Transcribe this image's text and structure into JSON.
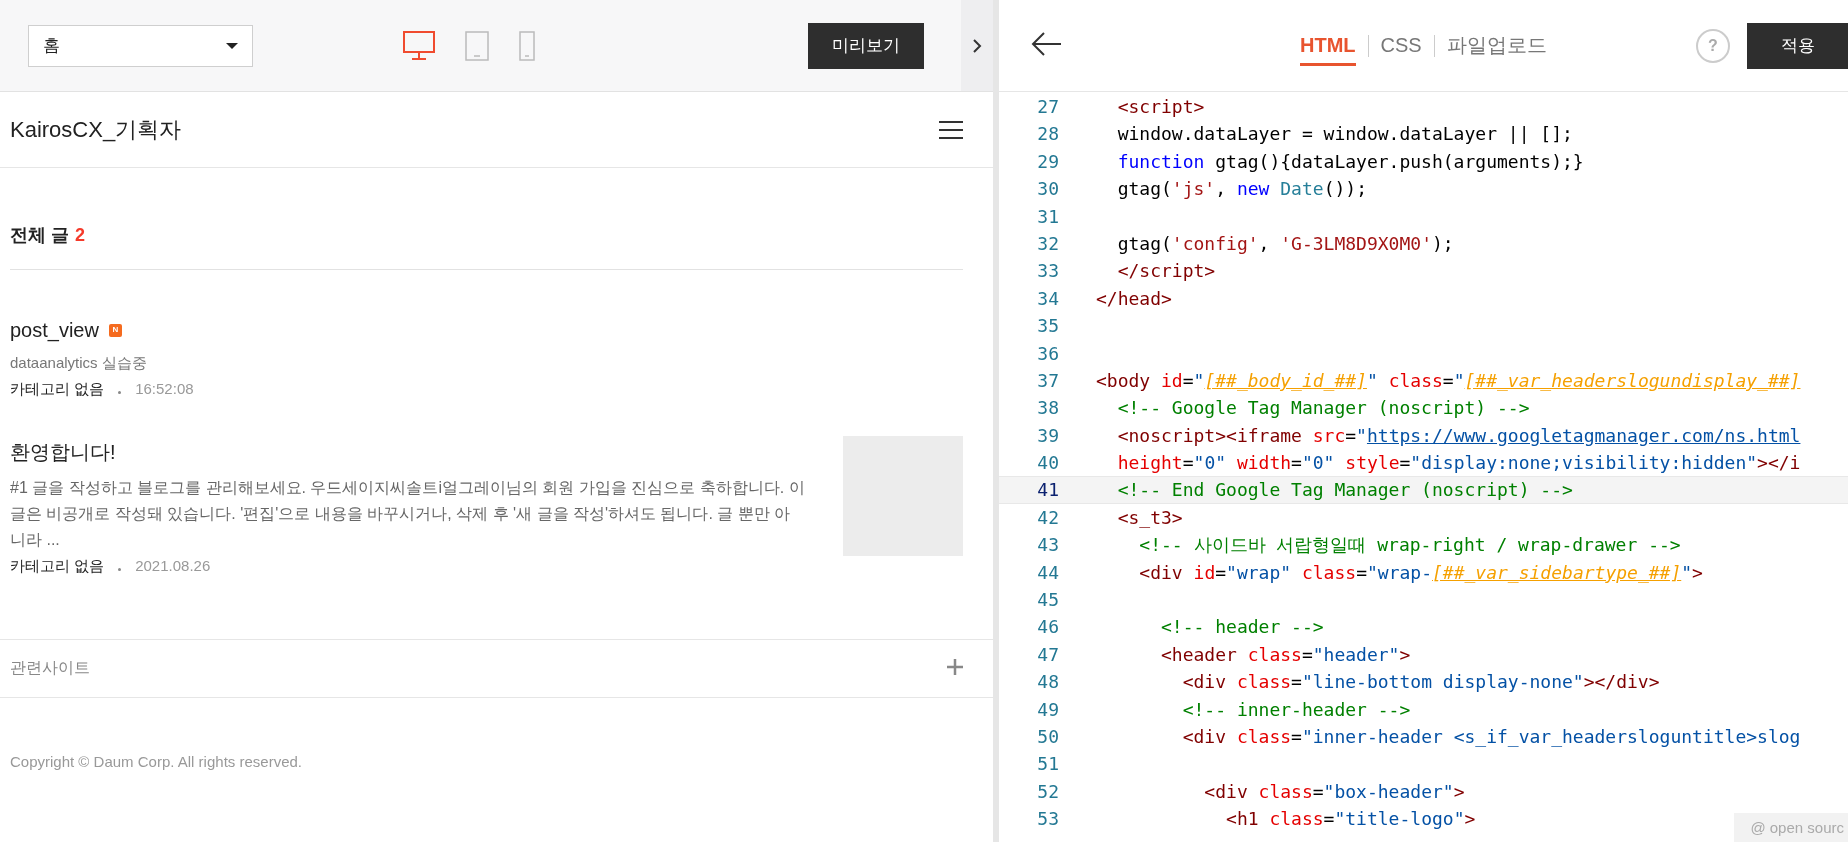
{
  "toolbar": {
    "page_select": {
      "value": "홈"
    },
    "devices": [
      {
        "kind": "desktop",
        "selected": true
      },
      {
        "kind": "tablet",
        "selected": false
      },
      {
        "kind": "mobile",
        "selected": false
      }
    ],
    "preview_button": "미리보기"
  },
  "blog": {
    "title": "KairosCX_기획자",
    "section": {
      "label": "전체 글",
      "count": "2"
    },
    "posts": [
      {
        "title": "post_view",
        "badge": "N",
        "summary": "dataanalytics 실습중",
        "category": "카테고리 없음",
        "time": "16:52:08",
        "thumbnail": false
      },
      {
        "title": "환영합니다!",
        "summary": "#1 글을 작성하고 블로그를 관리해보세요. 우드세이지씨솔트i얼그레이님의 회원 가입을 진심으로 축하합니다. 이 글은 비공개로 작성돼 있습니다. '편집'으로 내용을 바꾸시거나, 삭제 후 '새 글을 작성'하셔도 됩니다. 글 뿐만 아니라 ...",
        "category": "카테고리 없음",
        "time": "2021.08.26",
        "thumbnail": true
      }
    ],
    "related": {
      "label": "관련사이트"
    },
    "copyright": "Copyright © Daum Corp. All rights reserved."
  },
  "editor": {
    "tabs": [
      {
        "label": "HTML",
        "selected": true
      },
      {
        "label": "CSS",
        "selected": false
      },
      {
        "label": "파일업로드",
        "selected": false
      }
    ],
    "help_button": "?",
    "apply_button": "적용",
    "lines": [
      {
        "number": "27",
        "current": false,
        "tokens": [
          {
            "kind": "tag",
            "text": "  <script>"
          }
        ]
      },
      {
        "number": "28",
        "current": false,
        "tokens": [
          {
            "kind": "plain",
            "text": "  window.dataLayer = window.dataLayer || [];"
          }
        ]
      },
      {
        "number": "29",
        "current": false,
        "tokens": [
          {
            "kind": "keyword",
            "text": "  function"
          },
          {
            "kind": "plain",
            "text": " gtag(){dataLayer.push(arguments);}"
          }
        ]
      },
      {
        "number": "30",
        "current": false,
        "tokens": [
          {
            "kind": "plain",
            "text": "  gtag("
          },
          {
            "kind": "string",
            "text": "'js'"
          },
          {
            "kind": "plain",
            "text": ", "
          },
          {
            "kind": "keyword",
            "text": "new "
          },
          {
            "kind": "type",
            "text": "Date"
          },
          {
            "kind": "plain",
            "text": "());"
          }
        ]
      },
      {
        "number": "31",
        "current": false
      },
      {
        "number": "32",
        "current": false,
        "tokens": [
          {
            "kind": "plain",
            "text": "  gtag("
          },
          {
            "kind": "string",
            "text": "'config'"
          },
          {
            "kind": "plain",
            "text": ", "
          },
          {
            "kind": "string",
            "text": "'G-3LM8D9X0M0'"
          },
          {
            "kind": "plain",
            "text": ");"
          }
        ]
      },
      {
        "number": "33",
        "current": false,
        "tokens": [
          {
            "kind": "tag",
            "text": "  </script>"
          }
        ]
      },
      {
        "number": "34",
        "current": false,
        "tokens": [
          {
            "kind": "tag",
            "text": "</head>"
          }
        ]
      },
      {
        "number": "35",
        "current": false
      },
      {
        "number": "36",
        "current": false
      },
      {
        "number": "37",
        "current": false,
        "tokens": [
          {
            "kind": "tag",
            "text": "<body"
          },
          {
            "kind": "attr",
            "text": " id"
          },
          {
            "kind": "plain",
            "text": "="
          },
          {
            "kind": "value",
            "text": "\""
          },
          {
            "kind": "var",
            "text": "[##_body_id_##]"
          },
          {
            "kind": "value",
            "text": "\""
          },
          {
            "kind": "attr",
            "text": " class"
          },
          {
            "kind": "plain",
            "text": "="
          },
          {
            "kind": "value",
            "text": "\""
          },
          {
            "kind": "var",
            "text": "[##_var_headerslogundisplay_##]"
          }
        ]
      },
      {
        "number": "38",
        "current": false,
        "tokens": [
          {
            "kind": "comment",
            "text": "  <!-- Google Tag Manager (noscript) -->"
          }
        ]
      },
      {
        "number": "39",
        "current": false,
        "tokens": [
          {
            "kind": "tag",
            "text": "  <noscript><iframe"
          },
          {
            "kind": "attr",
            "text": " src"
          },
          {
            "kind": "plain",
            "text": "="
          },
          {
            "kind": "value",
            "text": "\""
          },
          {
            "kind": "link",
            "text": "https://www.googletagmanager.com/ns.html"
          }
        ]
      },
      {
        "number": "40",
        "current": false,
        "tokens": [
          {
            "kind": "attr",
            "text": "  height"
          },
          {
            "kind": "plain",
            "text": "="
          },
          {
            "kind": "value",
            "text": "\"0\""
          },
          {
            "kind": "attr",
            "text": " width"
          },
          {
            "kind": "plain",
            "text": "="
          },
          {
            "kind": "value",
            "text": "\"0\""
          },
          {
            "kind": "attr",
            "text": " style"
          },
          {
            "kind": "plain",
            "text": "="
          },
          {
            "kind": "value",
            "text": "\"display:none;visibility:hidden\""
          },
          {
            "kind": "tag",
            "text": "></i"
          }
        ]
      },
      {
        "number": "41",
        "current": true,
        "tokens": [
          {
            "kind": "comment",
            "text": "  <!-- End Google Tag Manager (noscript) -->"
          }
        ]
      },
      {
        "number": "42",
        "current": false,
        "tokens": [
          {
            "kind": "tag",
            "text": "  <s_t3>"
          }
        ]
      },
      {
        "number": "43",
        "current": false,
        "tokens": [
          {
            "kind": "comment",
            "text": "    <!-- 사이드바 서랍형일때 wrap-right / wrap-drawer -->"
          }
        ]
      },
      {
        "number": "44",
        "current": false,
        "tokens": [
          {
            "kind": "tag",
            "text": "    <div"
          },
          {
            "kind": "attr",
            "text": " id"
          },
          {
            "kind": "plain",
            "text": "="
          },
          {
            "kind": "value",
            "text": "\"wrap\""
          },
          {
            "kind": "attr",
            "text": " class"
          },
          {
            "kind": "plain",
            "text": "="
          },
          {
            "kind": "value",
            "text": "\"wrap-"
          },
          {
            "kind": "var",
            "text": "[##_var_sidebartype_##]"
          },
          {
            "kind": "value",
            "text": "\""
          },
          {
            "kind": "tag",
            "text": ">"
          }
        ]
      },
      {
        "number": "45",
        "current": false
      },
      {
        "number": "46",
        "current": false,
        "tokens": [
          {
            "kind": "comment",
            "text": "      <!-- header -->"
          }
        ]
      },
      {
        "number": "47",
        "current": false,
        "tokens": [
          {
            "kind": "tag",
            "text": "      <header"
          },
          {
            "kind": "attr",
            "text": " class"
          },
          {
            "kind": "plain",
            "text": "="
          },
          {
            "kind": "value",
            "text": "\"header\""
          },
          {
            "kind": "tag",
            "text": ">"
          }
        ]
      },
      {
        "number": "48",
        "current": false,
        "tokens": [
          {
            "kind": "tag",
            "text": "        <div"
          },
          {
            "kind": "attr",
            "text": " class"
          },
          {
            "kind": "plain",
            "text": "="
          },
          {
            "kind": "value",
            "text": "\"line-bottom display-none\""
          },
          {
            "kind": "tag",
            "text": "></div>"
          }
        ]
      },
      {
        "number": "49",
        "current": false,
        "tokens": [
          {
            "kind": "comment",
            "text": "        <!-- inner-header -->"
          }
        ]
      },
      {
        "number": "50",
        "current": false,
        "tokens": [
          {
            "kind": "tag",
            "text": "        <div"
          },
          {
            "kind": "attr",
            "text": " class"
          },
          {
            "kind": "plain",
            "text": "="
          },
          {
            "kind": "value",
            "text": "\"inner-header <s_if_var_headersloguntitle>slog"
          }
        ]
      },
      {
        "number": "51",
        "current": false
      },
      {
        "number": "52",
        "current": false,
        "tokens": [
          {
            "kind": "tag",
            "text": "          <div"
          },
          {
            "kind": "attr",
            "text": " class"
          },
          {
            "kind": "plain",
            "text": "="
          },
          {
            "kind": "value",
            "text": "\"box-header\""
          },
          {
            "kind": "tag",
            "text": ">"
          }
        ]
      },
      {
        "number": "53",
        "current": false,
        "tokens": [
          {
            "kind": "tag",
            "text": "            <h1"
          },
          {
            "kind": "attr",
            "text": " class"
          },
          {
            "kind": "plain",
            "text": "="
          },
          {
            "kind": "value",
            "text": "\"title-logo\""
          },
          {
            "kind": "tag",
            "text": ">"
          }
        ]
      }
    ],
    "badge": "@ open sourc"
  }
}
